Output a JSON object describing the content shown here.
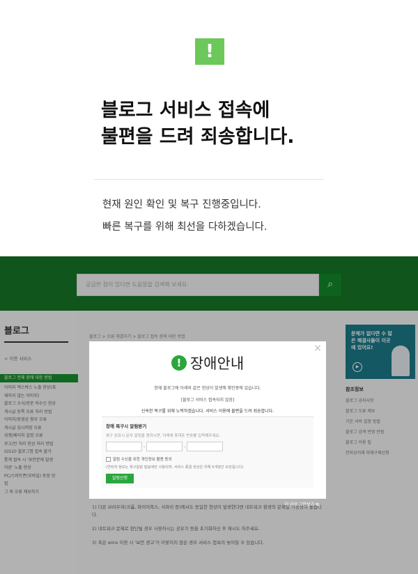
{
  "notice": {
    "icon_glyph": "!",
    "icon_color": "#6cc85a",
    "headline_line1": "블로그 서비스 접속에",
    "headline_line2": "불편을 드려 죄송합니다.",
    "desc_line1": "현재 원인 확인 및 복구 진행중입니다.",
    "desc_line2": "빠른 복구를 위해 최선을 다하겠습니다."
  },
  "site": {
    "brand_color": "#1a9131",
    "search_placeholder": "궁금한 점이 있다면 도움말을 검색해 보세요.",
    "search_icon": "search-icon",
    "blog_title": "블로그",
    "back_link": "< 이용 서비스",
    "sidebar_active": "블로그 전체 장애 대응 방법",
    "sidebar_items": [
      "이미지 엑스박스 노출 현상(혹",
      "재하지 않는 이미지)",
      "블로그 소식/방문 미수신 현상",
      "게시글 등록 오류 처리 방법",
      "이미지/동영상 첨부 오류",
      "게시글 임시저장 오류",
      "위젯/페이지 설정 오류",
      "로고/인 처리 현상 처리 방법",
      "iOS10 블로그앱 접속 불가",
      "통계 접속 시 '보안문제 발생",
      "이른' 노출 현상",
      "PC/스마트폰(모바일) 동장 방",
      "법",
      "그 외 오류 제보하기"
    ],
    "breadcrumb": "블로그 > 오류 해결하기 > 블로그 접속 장애 대응 방법",
    "article": [
      "1) 다른 브라우저(크롬, 파이어폭스, 사파리 등)에서도 동일한 현상이 발생한다면 네트워크 환경의 문제일 가능성이 높습니다.",
      "2) 네트워크 문제로 판단될 경우 사용하시는 공유기 등을 초기화하신 후 재시도 하주세요.",
      "3) 혹은 wins 이용 시 '보안 경고'가 이렇지지 않은 경우 서비스 접속이 늦어질 수 있습니다."
    ],
    "banner_text": "문제가 없다면 수 많은 해결사들이 이곳에 있어요!",
    "refs_title": "참조정보",
    "refs": [
      "블로그 공지사항",
      "블로그 오류 제보",
      "기본 서비 설정 방법",
      "블로그 검색 반영 안됨",
      "블로그 이용 팁",
      "전자상거래 피해구제신청"
    ]
  },
  "modal": {
    "title": "장애안내",
    "icon_glyph": "!",
    "close_glyph": "×",
    "line1": "현재 블로그에 아래와 같은 현상이 발생해 확인중에 있습니다.",
    "line2": "[블로그 서비스 접속되지 않음]",
    "line3": "신속한 복구를 위해 노력하겠습니다. 서비스 이용에 불편을 드려 죄송합니다.",
    "form_title": "장애 복구시 알림받기",
    "form_help": "복구 완료시 문자 알림을 원하시면, 아래에 휴대폰 번호를 입력해주세요.",
    "consent_label": "알림 수신을 위한 개인정보 활용 동의",
    "consent_note": "(연락처 정보는 복구알림 발송에만 사용되며, 서비스 종결 현상은 위해 6개월간 보관됩니다)",
    "submit_label": "알림신청",
    "more_label": "더 이상 그만보기 ⊠"
  }
}
